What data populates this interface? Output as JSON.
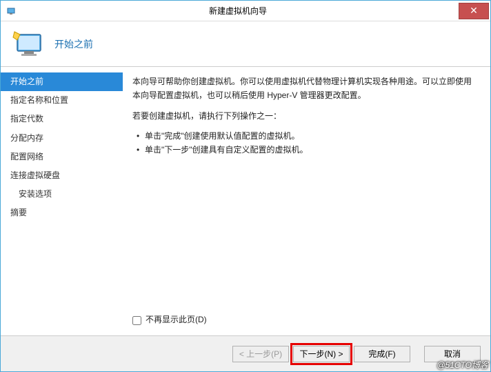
{
  "window": {
    "title": "新建虚拟机向导",
    "close_symbol": "✕"
  },
  "header": {
    "title": "开始之前"
  },
  "sidebar": {
    "items": [
      {
        "label": "开始之前",
        "selected": true
      },
      {
        "label": "指定名称和位置"
      },
      {
        "label": "指定代数"
      },
      {
        "label": "分配内存"
      },
      {
        "label": "配置网络"
      },
      {
        "label": "连接虚拟硬盘"
      },
      {
        "label": "安装选项",
        "indent": true
      },
      {
        "label": "摘要"
      }
    ]
  },
  "content": {
    "p1": "本向导可帮助你创建虚拟机。你可以使用虚拟机代替物理计算机实现各种用途。可以立即使用本向导配置虚拟机，也可以稍后使用 Hyper-V 管理器更改配置。",
    "p2": "若要创建虚拟机，请执行下列操作之一：",
    "bullets": [
      "单击\"完成\"创建使用默认值配置的虚拟机。",
      "单击\"下一步\"创建具有自定义配置的虚拟机。"
    ],
    "checkbox_label": "不再显示此页(D)"
  },
  "footer": {
    "prev": "< 上一步(P)",
    "next": "下一步(N) >",
    "finish": "完成(F)",
    "cancel": "取消"
  },
  "watermark": "@51CTO博客"
}
